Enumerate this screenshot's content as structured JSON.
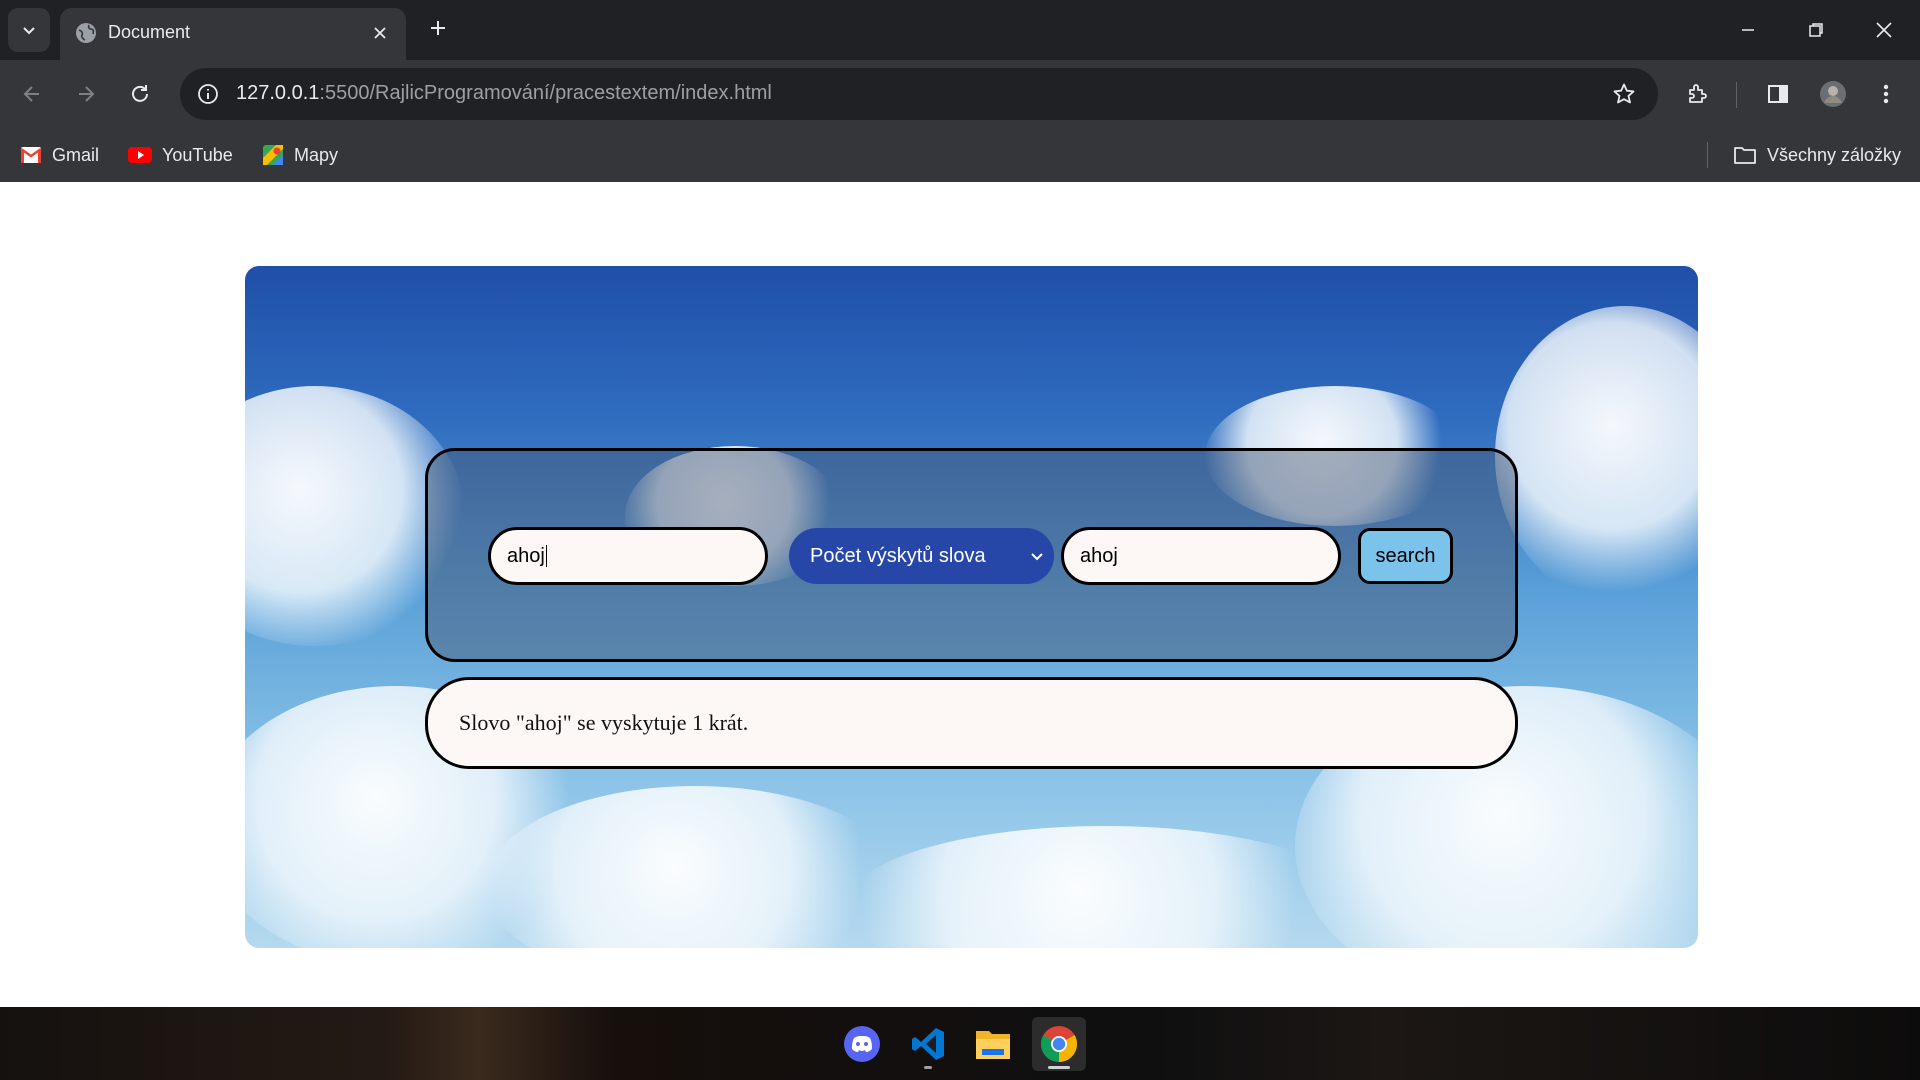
{
  "browser": {
    "tab_title": "Document",
    "url_host": "127.0.0.1",
    "url_path": ":5500/RajlicProgramování/pracestextem/index.html",
    "bookmarks": [
      {
        "label": "Gmail",
        "icon": "gmail-icon"
      },
      {
        "label": "YouTube",
        "icon": "youtube-icon"
      },
      {
        "label": "Mapy",
        "icon": "maps-icon"
      }
    ],
    "all_bookmarks_label": "Všechny záložky"
  },
  "page": {
    "input_value": "ahoj",
    "select_value": "Počet výskytů slova",
    "second_input_value": "ahoj",
    "search_label": "search",
    "result_text": "Slovo \"ahoj\" se vyskytuje 1 krát.",
    "colors": {
      "select_bg": "#2647a8",
      "button_bg": "#7cc3ec",
      "field_bg": "#fdf8f6"
    }
  },
  "taskbar": {
    "apps": [
      "discord-icon",
      "vscode-icon",
      "file-explorer-icon",
      "chrome-icon"
    ]
  }
}
